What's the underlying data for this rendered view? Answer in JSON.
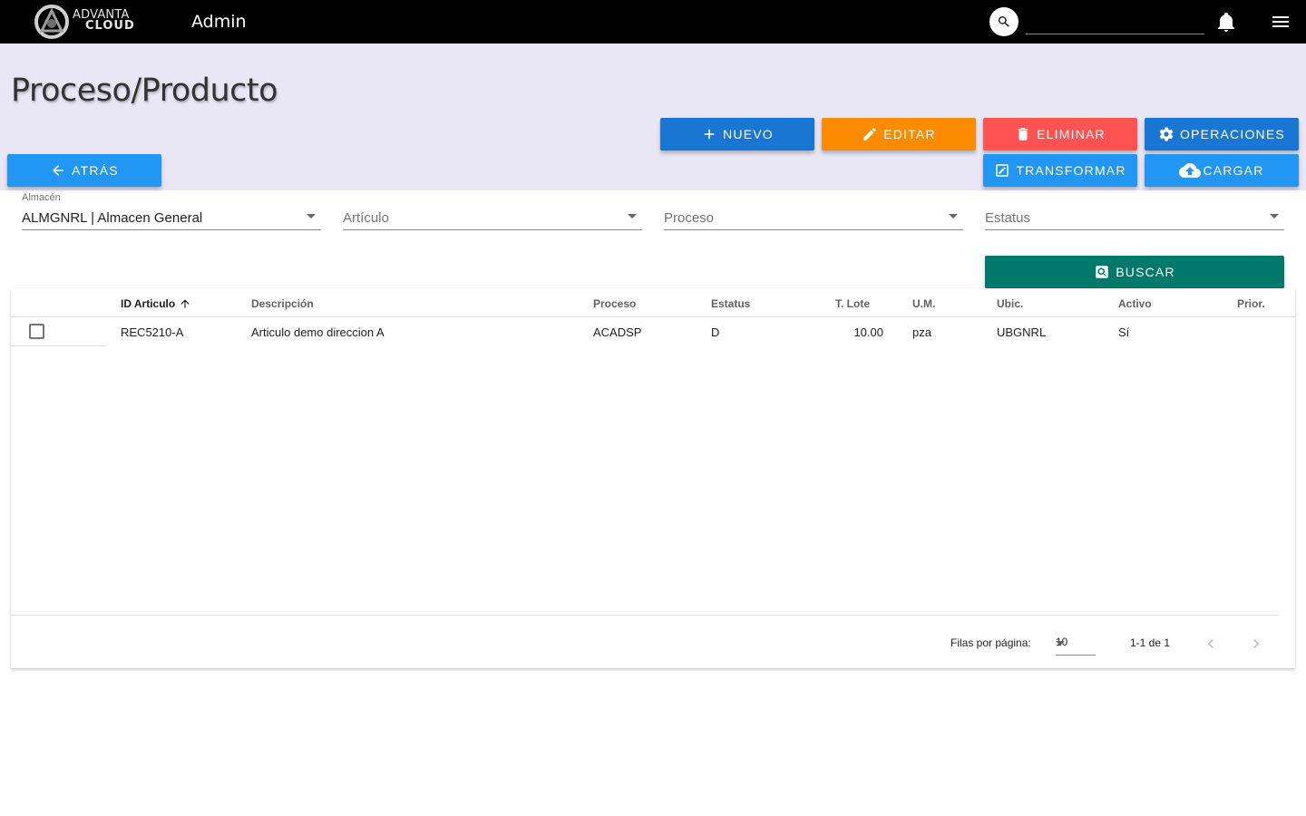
{
  "header": {
    "logo_line1": "ADVANTA",
    "logo_line2": "CLOUD",
    "title": "Admin",
    "search_placeholder": ""
  },
  "page": {
    "title": "Proceso/Producto"
  },
  "actions": {
    "nuevo": "NUEVO",
    "editar": "EDITAR",
    "eliminar": "ELIMINAR",
    "operaciones": "OPERACIONES",
    "atras": "ATRÁS",
    "transformar": "TRANSFORMAR",
    "cargar": "CARGAR",
    "buscar": "BUSCAR"
  },
  "filters": {
    "almacen": {
      "label": "Almacén",
      "value": "ALMGNRL | Almacen General"
    },
    "articulo": {
      "placeholder": "Artículo"
    },
    "proceso": {
      "placeholder": "Proceso"
    },
    "estatus": {
      "placeholder": "Estatus"
    }
  },
  "table": {
    "headers": [
      "ID Articulo",
      "Descripción",
      "Proceso",
      "Estatus",
      "T. Lote",
      "U.M.",
      "Ubic.",
      "Activo",
      "Prior."
    ],
    "sorted_column": "ID Articulo",
    "sort_direction": "ascending",
    "rows": [
      {
        "id": "REC5210-A",
        "descripcion": "Articulo demo direccion A",
        "proceso": "ACADSP",
        "estatus": "D",
        "lote": "10.00",
        "um": "pza",
        "ubic": "UBGNRL",
        "activo": "Sí",
        "prior": ""
      }
    ]
  },
  "pagination": {
    "rows_per_page_label": "Filas por página:",
    "rows_per_page": "10",
    "range": "1-1 de 1"
  },
  "colors": {
    "topbar": "#000000",
    "band": "#e9e6f6",
    "nuevo": "#1976d2",
    "editar": "#fb8c00",
    "eliminar": "#ff5252",
    "operaciones": "#1976d2",
    "atras": "#2196f3",
    "transformar": "#2196f3",
    "cargar": "#2196f3",
    "buscar": "#00796b"
  },
  "icons": {
    "logo": "advanta-logo-icon",
    "search": "search-icon",
    "notifications": "bell-icon",
    "menu": "menu-icon",
    "nuevo": "plus-icon",
    "editar": "pencil-icon",
    "eliminar": "trash-icon",
    "operaciones": "gear-icon",
    "atras": "arrow-left-icon",
    "transformar": "edit-box-icon",
    "cargar": "cloud-upload-icon",
    "buscar": "search-box-icon",
    "sort": "arrow-up-icon",
    "prev": "chevron-left-icon",
    "next": "chevron-right-icon"
  }
}
